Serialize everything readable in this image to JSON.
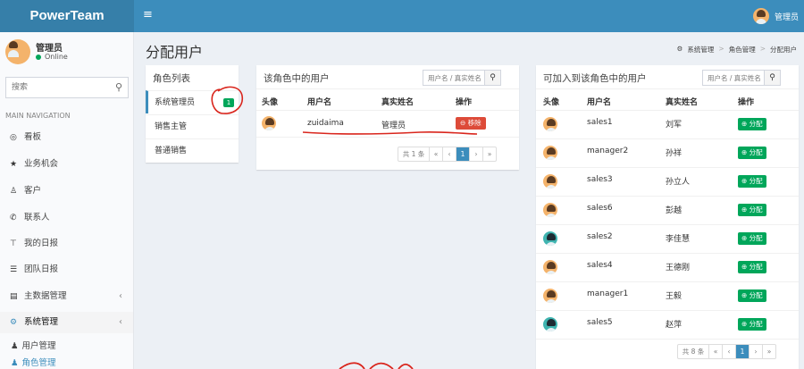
{
  "header": {
    "logo": "PowerTeam",
    "menu_icon": "≡",
    "user_name": "管理员"
  },
  "sidebar": {
    "user_name": "管理员",
    "status": "Online",
    "search_placeholder": "搜索",
    "nav_header": "MAIN NAVIGATION",
    "items": [
      {
        "label": "看板",
        "icon": "dashboard-icon",
        "glyph": "◎"
      },
      {
        "label": "业务机会",
        "icon": "star-icon",
        "glyph": "★"
      },
      {
        "label": "客户",
        "icon": "users-icon",
        "glyph": "♙"
      },
      {
        "label": "联系人",
        "icon": "phone-icon",
        "glyph": "✆"
      },
      {
        "label": "我的日报",
        "icon": "pin-icon",
        "glyph": "⊤"
      },
      {
        "label": "团队日报",
        "icon": "list-icon",
        "glyph": "☰"
      },
      {
        "label": "主数据管理",
        "icon": "database-icon",
        "glyph": "▤"
      },
      {
        "label": "系统管理",
        "icon": "cogs-icon",
        "glyph": "⚙"
      }
    ],
    "subitems": [
      {
        "label": "用户管理",
        "icon": "user-icon",
        "glyph": "♟"
      },
      {
        "label": "角色管理",
        "icon": "users-icon",
        "glyph": "♟"
      }
    ],
    "chevron": "‹"
  },
  "page": {
    "title": "分配用户",
    "breadcrumb": {
      "icon_glyph": "⚙",
      "items": [
        "系统管理",
        "角色管理",
        "分配用户"
      ],
      "sep": ">"
    }
  },
  "role_list": {
    "title": "角色列表",
    "roles": [
      {
        "name": "系统管理员",
        "badge": "1"
      },
      {
        "name": "销售主管"
      },
      {
        "name": "普通销售"
      }
    ]
  },
  "in_role": {
    "title": "该角色中的用户",
    "search_placeholder": "用户名 / 真实姓名",
    "search_glyph": "⚲",
    "headers": [
      "头像",
      "用户名",
      "真实姓名",
      "操作"
    ],
    "rows": [
      {
        "username": "zuidaima",
        "realname": "管理员",
        "action": "⊖ 移除"
      }
    ],
    "pager": {
      "total": "共 1 条",
      "first": "«",
      "prev": "‹",
      "page": "1",
      "next": "›",
      "last": "»"
    }
  },
  "available": {
    "title": "可加入到该角色中的用户",
    "search_placeholder": "用户名 / 真实姓名",
    "search_glyph": "⚲",
    "headers": [
      "头像",
      "用户名",
      "真实姓名",
      "操作"
    ],
    "rows": [
      {
        "username": "sales1",
        "realname": "刘军",
        "action": "⊕ 分配",
        "avatar": "orange"
      },
      {
        "username": "manager2",
        "realname": "孙祥",
        "action": "⊕ 分配",
        "avatar": "orange"
      },
      {
        "username": "sales3",
        "realname": "孙立人",
        "action": "⊕ 分配",
        "avatar": "orange"
      },
      {
        "username": "sales6",
        "realname": "彭越",
        "action": "⊕ 分配",
        "avatar": "orange"
      },
      {
        "username": "sales2",
        "realname": "李佳慧",
        "action": "⊕ 分配",
        "avatar": "teal"
      },
      {
        "username": "sales4",
        "realname": "王德刚",
        "action": "⊕ 分配",
        "avatar": "orange"
      },
      {
        "username": "manager1",
        "realname": "王毅",
        "action": "⊕ 分配",
        "avatar": "orange"
      },
      {
        "username": "sales5",
        "realname": "赵萍",
        "action": "⊕ 分配",
        "avatar": "teal"
      }
    ],
    "pager": {
      "total": "共 8 条",
      "first": "«",
      "prev": "‹",
      "page": "1",
      "next": "›",
      "last": "»"
    }
  },
  "colors": {
    "header": "#3c8dbc",
    "logo_bg": "#367fa9",
    "red": "#dd4b39",
    "green": "#00a65a",
    "annotation": "#d9251c"
  }
}
